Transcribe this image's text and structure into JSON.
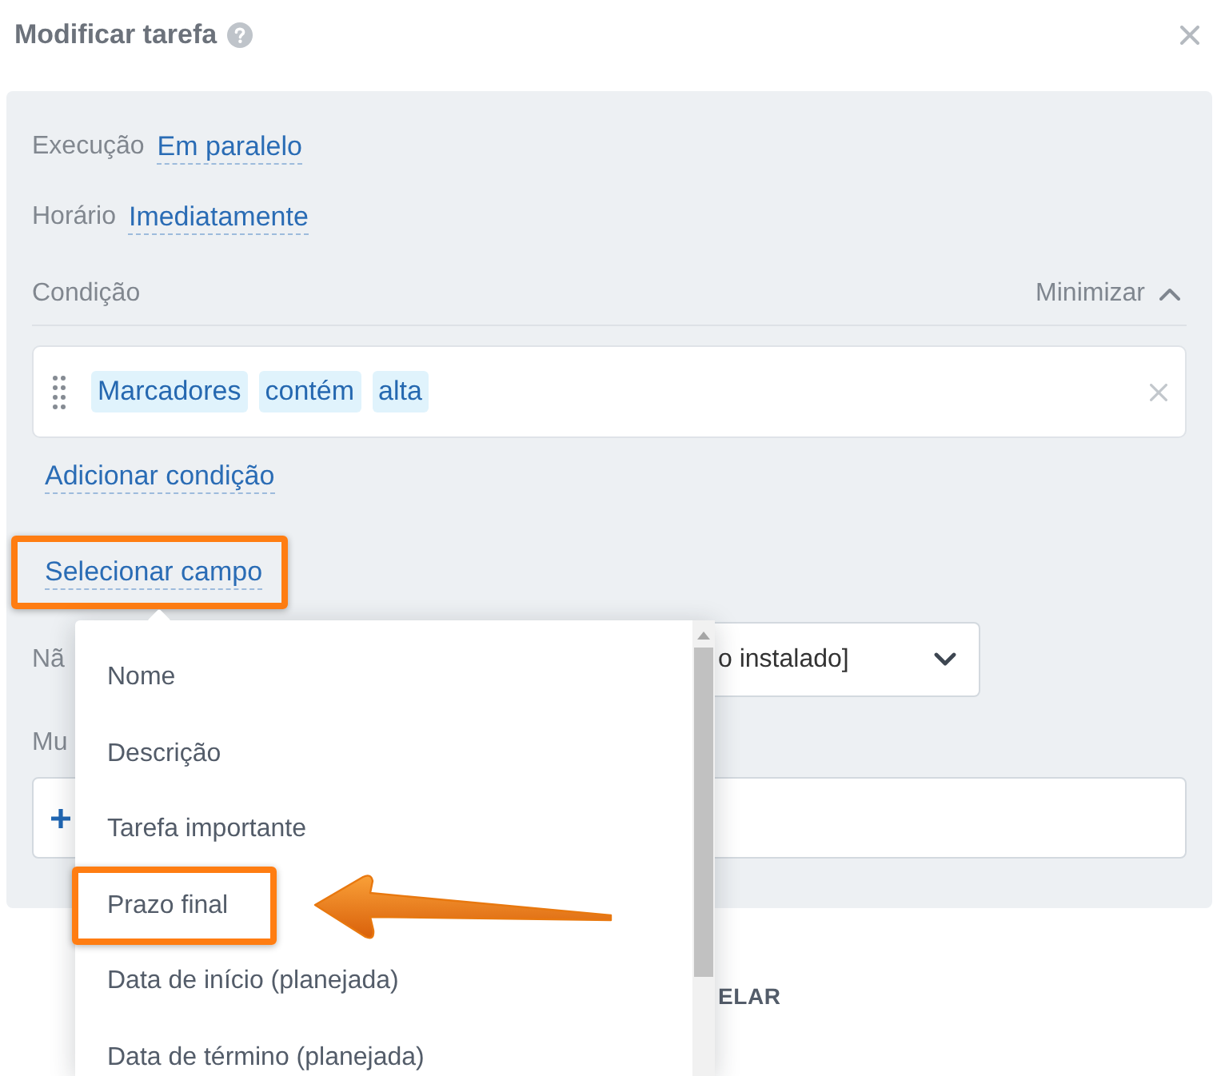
{
  "dialog": {
    "title": "Modificar tarefa"
  },
  "settings": [
    {
      "label": "Execução",
      "value": "Em paralelo"
    },
    {
      "label": "Horário",
      "value": "Imediatamente"
    }
  ],
  "condition_section": {
    "label": "Condição",
    "toggle": "Minimizar",
    "expanded": true,
    "conditions": [
      {
        "field": "Marcadores",
        "operator": "contém",
        "value": "alta"
      }
    ],
    "add_link": "Adicionar condição"
  },
  "select_field": {
    "label": "Selecionar campo",
    "annotated": true
  },
  "field_row": {
    "label": "Nã",
    "value": "o instalado]"
  },
  "change_row": {
    "label": "Mu"
  },
  "footer": {
    "button": "ELAR"
  },
  "field_menu": {
    "items": [
      {
        "label": "Nome",
        "annotated": false,
        "arrow": false
      },
      {
        "label": "Descrição",
        "annotated": false,
        "arrow": false
      },
      {
        "label": "Tarefa importante",
        "annotated": false,
        "arrow": false
      },
      {
        "label": "Prazo final",
        "annotated": true,
        "arrow": true
      },
      {
        "label": "Data de início (planejada)",
        "annotated": false,
        "arrow": false
      },
      {
        "label": "Data de término (planejada)",
        "annotated": false,
        "arrow": false
      }
    ]
  }
}
